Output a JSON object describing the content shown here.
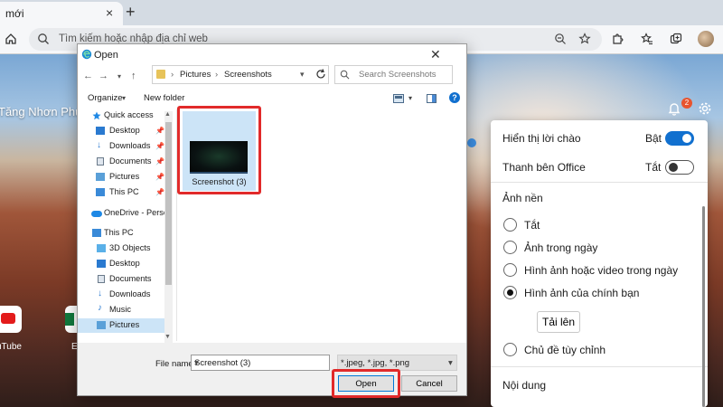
{
  "browser": {
    "tab_title": "mới",
    "tab_close": "×",
    "new_tab": "+",
    "address_placeholder": "Tìm kiếm hoặc nhập địa chỉ web"
  },
  "page": {
    "greeting": "Tăng Nhơn Phú B",
    "notification_count": "2",
    "quick_links": [
      {
        "label": "uTube"
      },
      {
        "label": "E"
      }
    ]
  },
  "settings_panel": {
    "show_greeting_label": "Hiển thị lời chào",
    "show_greeting_state": "Bật",
    "office_sidebar_label": "Thanh bên Office",
    "office_sidebar_state": "Tắt",
    "background_heading": "Ảnh nền",
    "background_options": [
      {
        "label": "Tắt",
        "checked": false
      },
      {
        "label": "Ảnh trong ngày",
        "checked": false
      },
      {
        "label": "Hình ảnh hoặc video trong ngày",
        "checked": false
      },
      {
        "label": "Hình ảnh của chính bạn",
        "checked": true
      }
    ],
    "upload_button": "Tải lên",
    "custom_theme_label": "Chủ đề tùy chỉnh",
    "content_heading": "Nội dung"
  },
  "dialog": {
    "title": "Open",
    "close": "✕",
    "path": [
      "Pictures",
      "Screenshots"
    ],
    "search_placeholder": "Search Screenshots",
    "organize_label": "Organize",
    "new_folder_label": "New folder",
    "nav_items": [
      {
        "label": "Quick access",
        "icon": "star-icon",
        "pinned": false,
        "selected": false
      },
      {
        "label": "Desktop",
        "icon": "desktop-icon",
        "pinned": true,
        "selected": false
      },
      {
        "label": "Downloads",
        "icon": "download-icon",
        "pinned": true,
        "selected": false
      },
      {
        "label": "Documents",
        "icon": "document-icon",
        "pinned": true,
        "selected": false
      },
      {
        "label": "Pictures",
        "icon": "pictures-icon",
        "pinned": true,
        "selected": false
      },
      {
        "label": "This PC",
        "icon": "pc-icon",
        "pinned": true,
        "selected": false
      },
      {
        "label": "OneDrive - Person",
        "icon": "cloud-icon",
        "pinned": false,
        "selected": false
      },
      {
        "label": "This PC",
        "icon": "pc-icon",
        "pinned": false,
        "selected": false
      },
      {
        "label": "3D Objects",
        "icon": "cube-icon",
        "pinned": false,
        "selected": false
      },
      {
        "label": "Desktop",
        "icon": "desktop-icon",
        "pinned": false,
        "selected": false
      },
      {
        "label": "Documents",
        "icon": "document-icon",
        "pinned": false,
        "selected": false
      },
      {
        "label": "Downloads",
        "icon": "download-icon",
        "pinned": false,
        "selected": false
      },
      {
        "label": "Music",
        "icon": "music-icon",
        "pinned": false,
        "selected": false
      },
      {
        "label": "Pictures",
        "icon": "pictures-icon",
        "pinned": false,
        "selected": true
      }
    ],
    "file": {
      "name": "Screenshot (3)"
    },
    "file_name_label": "File name:",
    "file_name_value": "Screenshot (3)",
    "file_type": "*.jpeg, *.jpg, *.png",
    "open_button": "Open",
    "cancel_button": "Cancel"
  },
  "colors": {
    "accent": "#1170cf",
    "highlight_border": "#e12a2a",
    "selection": "#cce4f7"
  }
}
